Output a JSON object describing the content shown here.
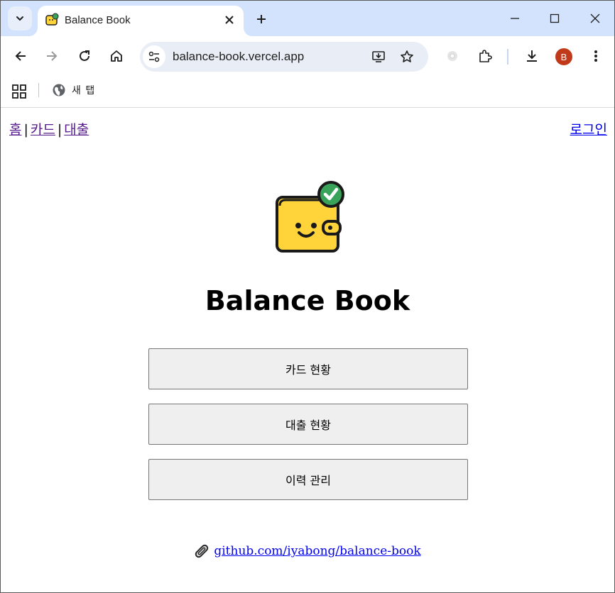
{
  "browser": {
    "tab": {
      "title": "Balance Book"
    },
    "address_bar": {
      "url": "balance-book.vercel.app"
    },
    "avatar_letter": "B",
    "bookmarks": [
      {
        "label": "새 탭",
        "icon": "globe-icon"
      }
    ]
  },
  "page": {
    "nav": {
      "home": "홈",
      "card": "카드",
      "loan": "대출",
      "separator": "|"
    },
    "login": "로그인",
    "title": "Balance Book",
    "buttons": [
      {
        "label": "카드 현황"
      },
      {
        "label": "대출 현황"
      },
      {
        "label": "이력 관리"
      }
    ],
    "footer": {
      "icon": "paperclip-icon",
      "link": "github.com/iyabong/balance-book"
    }
  },
  "colors": {
    "tabstrip": "#d3e3fd",
    "logo_wallet": "#ffd43b",
    "logo_check": "#3aa35a",
    "link_visited": "#551a8b",
    "link": "#0000ee",
    "avatar": "#c0391a"
  }
}
